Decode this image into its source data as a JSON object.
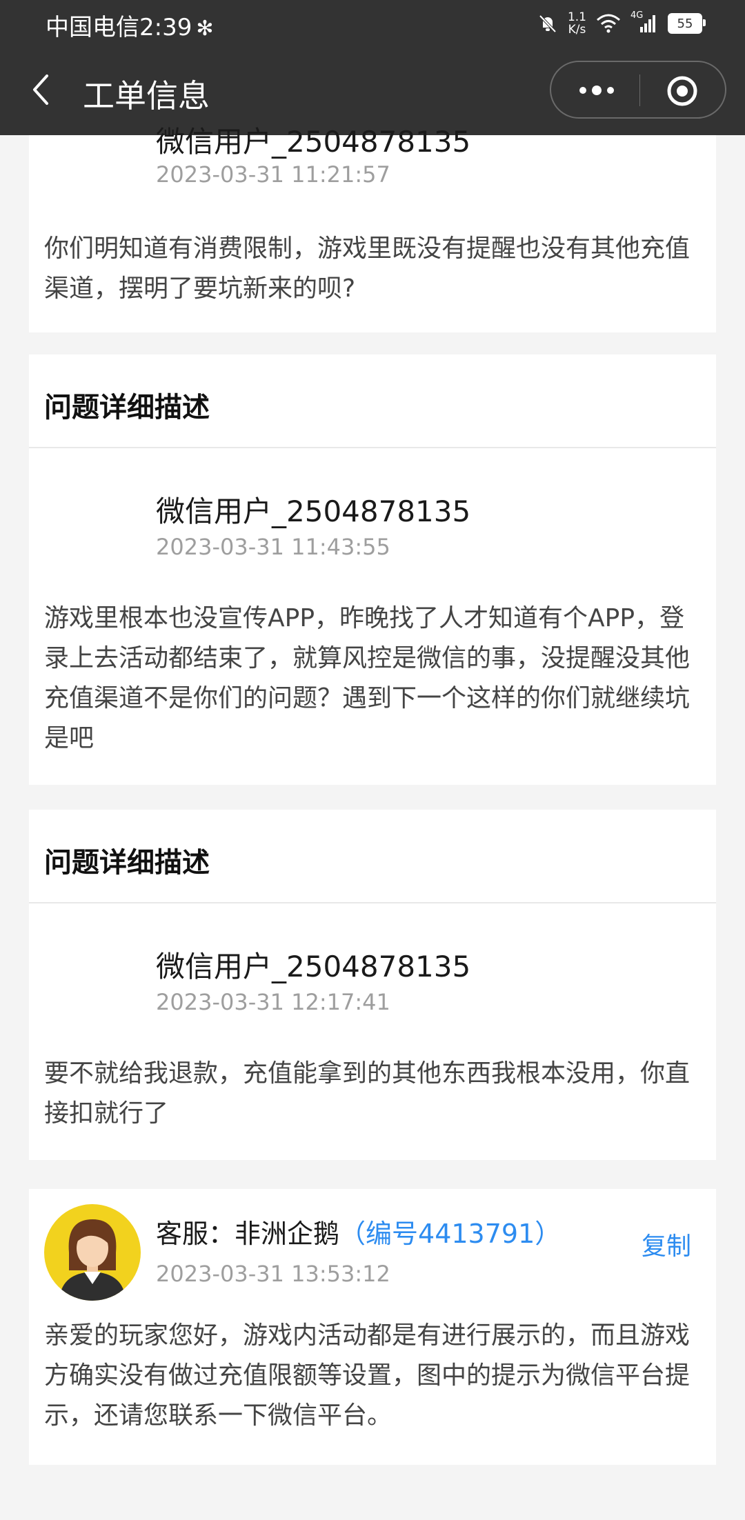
{
  "status_bar": {
    "carrier_time": "中国电信2:39",
    "bluetooth": "✻",
    "speed_top": "1.1",
    "speed_bottom": "K/s",
    "network": "4G",
    "battery": "55"
  },
  "nav": {
    "title": "工单信息"
  },
  "messages": [
    {
      "user": "微信用户_2504878135",
      "time": "2023-03-31 11:21:57",
      "text": "你们明知道有消费限制，游戏里既没有提醒也没有其他充值渠道，摆明了要坑新来的呗?"
    },
    {
      "section_title": "问题详细描述",
      "user": "微信用户_2504878135",
      "time": "2023-03-31 11:43:55",
      "text": "游戏里根本也没宣传APP，昨晚找了人才知道有个APP，登录上去活动都结束了，就算风控是微信的事，没提醒没其他充值渠道不是你们的问题？遇到下一个这样的你们就继续坑是吧"
    },
    {
      "section_title": "问题详细描述",
      "user": "微信用户_2504878135",
      "time": "2023-03-31 12:17:41",
      "text": "要不就给我退款，充值能拿到的其他东西我根本没用，你直接扣就行了"
    }
  ],
  "agent_reply": {
    "agent_label": "客服：非洲企鹅",
    "agent_id": "（编号4413791）",
    "copy_label": "复制",
    "time": "2023-03-31 13:53:12",
    "text": "亲爱的玩家您好，游戏内活动都是有进行展示的，而且游戏方确实没有做过充值限额等设置，图中的提示为微信平台提示，还请您联系一下微信平台。"
  },
  "colors": {
    "header_bg": "#333333",
    "page_bg": "#f4f4f4",
    "link_blue": "#2d8cf0",
    "avatar_bg": "#f2d21e"
  }
}
